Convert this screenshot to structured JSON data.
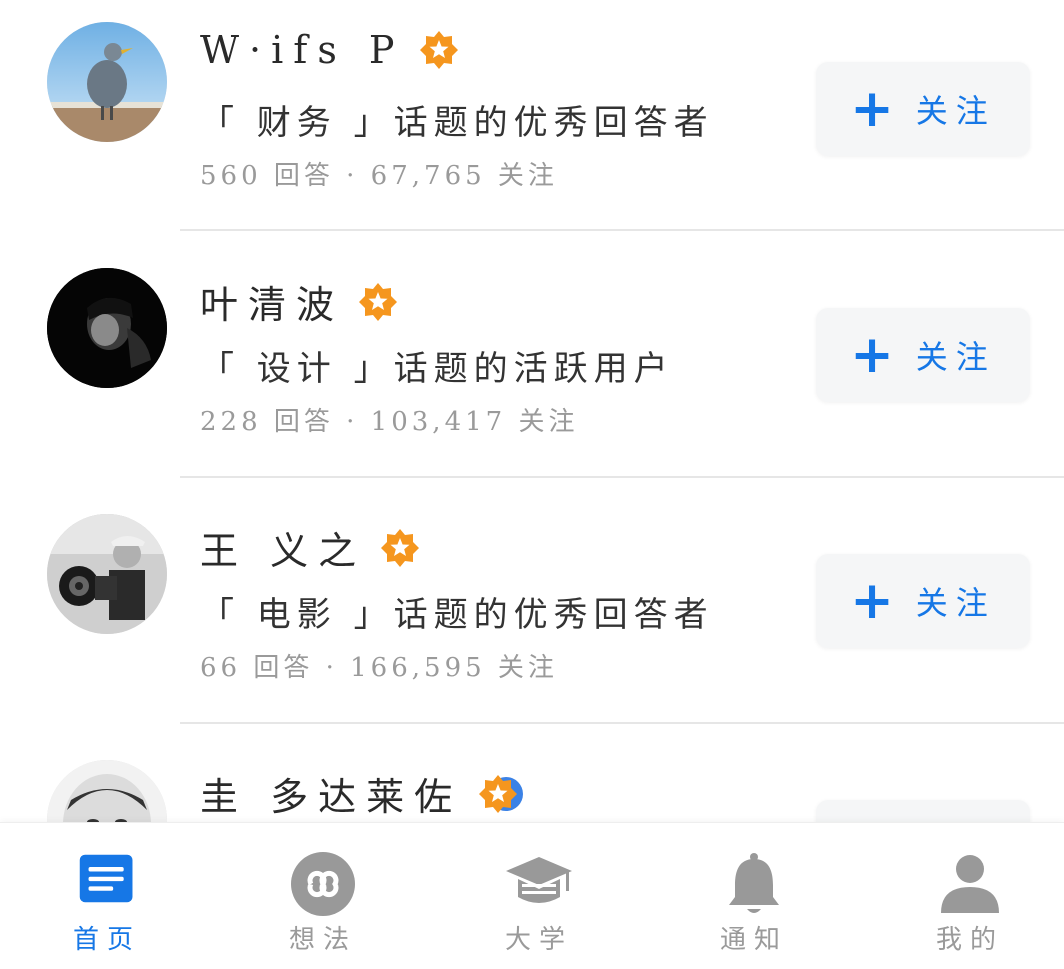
{
  "users": [
    {
      "name": "W·ifs P",
      "desc": "「 财务 」话题的优秀回答者",
      "stats": "560 回答 · 67,765 关注",
      "follow_label": "关注",
      "badge": "star-badge-icon"
    },
    {
      "name": "叶清波",
      "desc": "「 设计 」话题的活跃用户",
      "stats": "228 回答 · 103,417 关注",
      "follow_label": "关注",
      "badge": "star-badge-icon"
    },
    {
      "name": "王 义之",
      "desc": "「 电影 」话题的优秀回答者",
      "stats": "66 回答 · 166,595 关注",
      "follow_label": "关注",
      "badge": "star-badge-icon"
    },
    {
      "name": "圭 多达莱佐",
      "desc": "",
      "stats": "",
      "follow_label": "",
      "badge": "star-badge-icon"
    }
  ],
  "tabs": [
    {
      "label": "首页",
      "icon": "home-icon",
      "active": true
    },
    {
      "label": "想法",
      "icon": "ideas-icon",
      "active": false
    },
    {
      "label": "大学",
      "icon": "graduation-cap-icon",
      "active": false
    },
    {
      "label": "通知",
      "icon": "bell-icon",
      "active": false
    },
    {
      "label": "我的",
      "icon": "person-icon",
      "active": false
    }
  ],
  "colors": {
    "accent": "#1677e6",
    "badge": "#f5961e",
    "muted": "#9a9a9a"
  }
}
